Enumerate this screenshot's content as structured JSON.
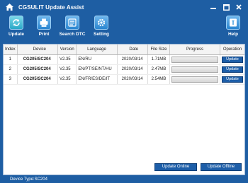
{
  "app": {
    "title": "CGSULIT Update Assist"
  },
  "toolbar": {
    "items": [
      {
        "label": "Update",
        "icon": "update-icon"
      },
      {
        "label": "Print",
        "icon": "print-icon"
      },
      {
        "label": "Search DTC",
        "icon": "search-dtc-icon"
      },
      {
        "label": "Setting",
        "icon": "setting-icon"
      },
      {
        "label": "Help",
        "icon": "help-icon"
      }
    ]
  },
  "table": {
    "headers": [
      "Index",
      "Device",
      "Version",
      "Language",
      "Date",
      "File Size",
      "Progress",
      "Operation"
    ],
    "rows": [
      {
        "index": "1",
        "device": "CG205/SC204",
        "version": "V2.35",
        "language": "EN/RU",
        "date": "2020/03/14",
        "size": "1.71MB",
        "progress": 0,
        "operation": "Update"
      },
      {
        "index": "2",
        "device": "CG205/SC204",
        "version": "V2.35",
        "language": "EN/PT/SE/NT/HU",
        "date": "2020/03/14",
        "size": "2.47MB",
        "progress": 0,
        "operation": "Update"
      },
      {
        "index": "3",
        "device": "CG205/SC204",
        "version": "V2.35",
        "language": "EN/FR/ES/DE/IT",
        "date": "2020/03/14",
        "size": "2.54MB",
        "progress": 0,
        "operation": "Update"
      }
    ]
  },
  "buttons": {
    "update_online": "Update Online",
    "update_offline": "Update Offline"
  },
  "status": {
    "device_type": "Device Type:SC204"
  },
  "colors": {
    "window_bg": "#1e5ea3",
    "button": "#1d5ea8",
    "icon_tile": "#3a98dc"
  }
}
